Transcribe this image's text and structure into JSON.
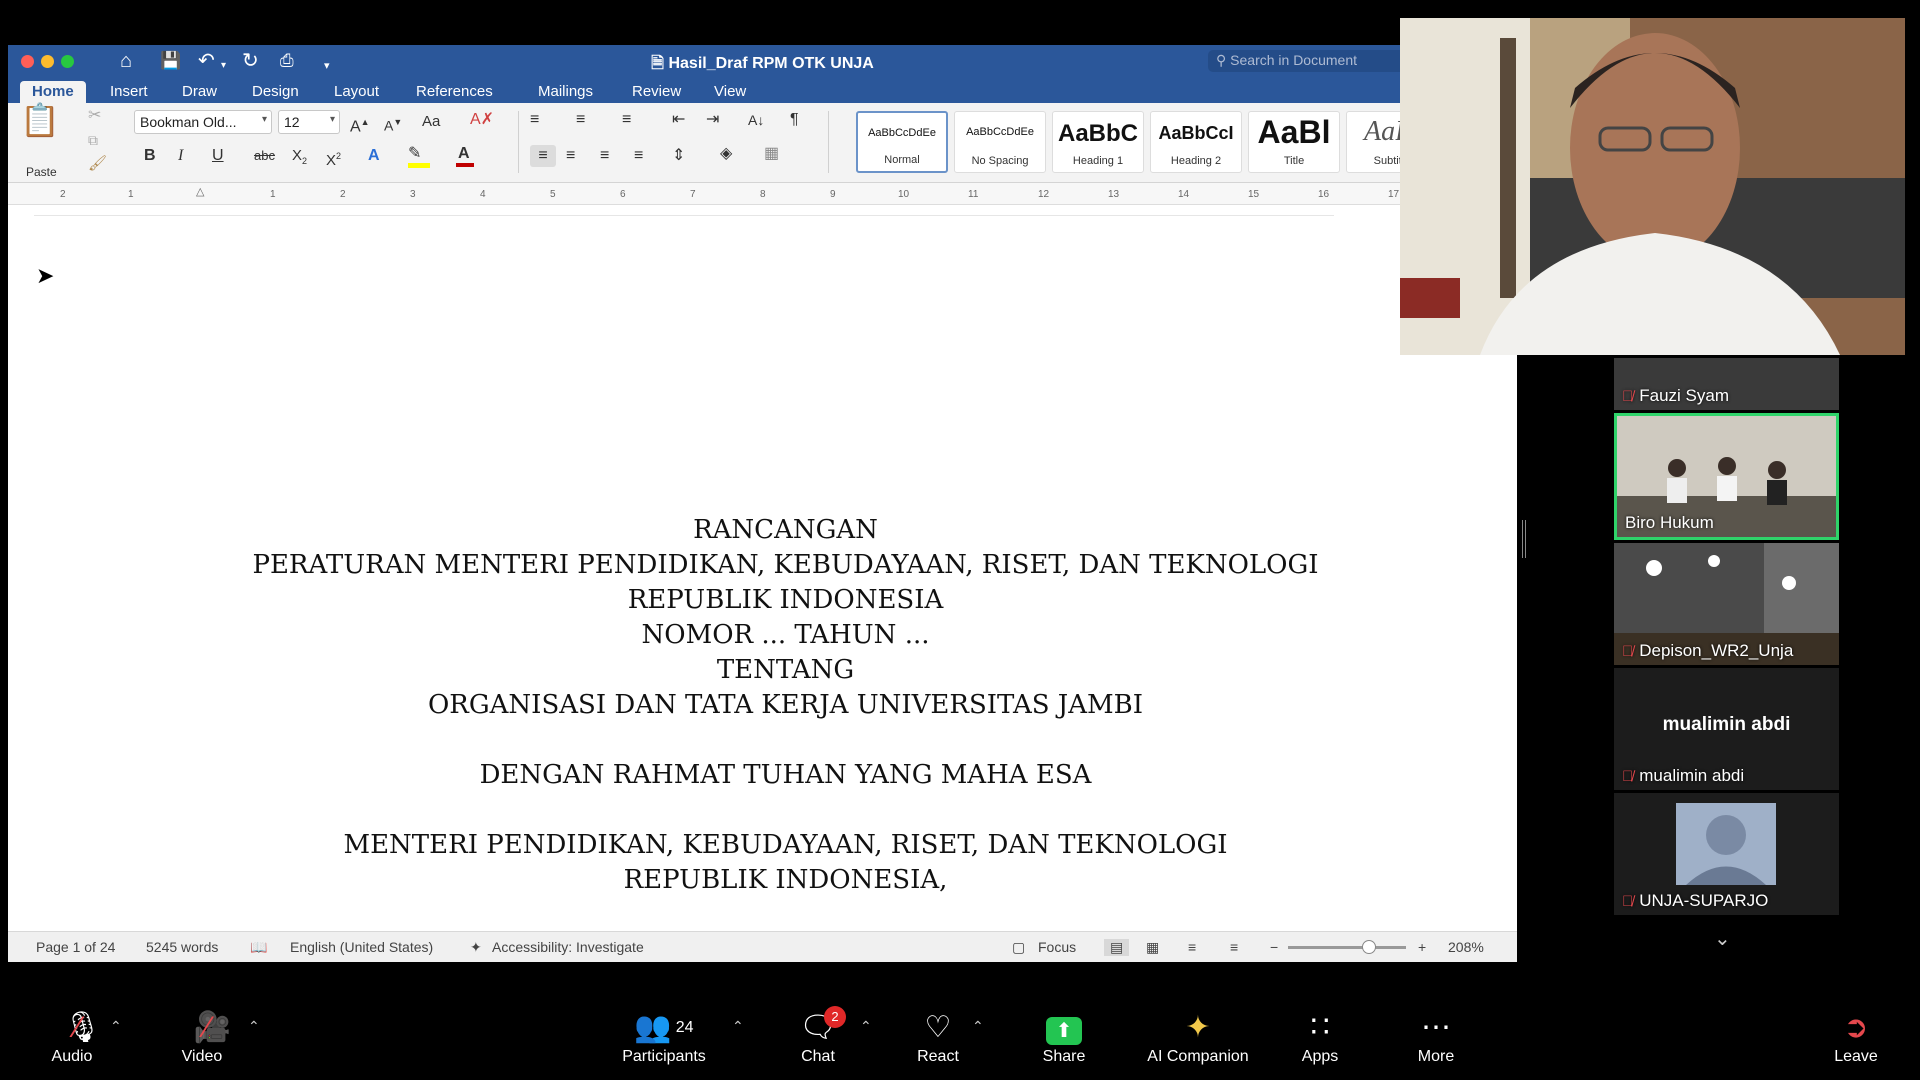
{
  "word": {
    "document_title": "Hasil_Draf RPM OTK UNJA",
    "search_placeholder": "Search in Document",
    "tabs": [
      "Home",
      "Insert",
      "Draw",
      "Design",
      "Layout",
      "References",
      "Mailings",
      "Review",
      "View"
    ],
    "active_tab": "Home",
    "ribbon": {
      "paste_label": "Paste",
      "font_name": "Bookman Old...",
      "font_size": "12",
      "styles": [
        {
          "preview": "AaBbCcDdEe",
          "name": "Normal"
        },
        {
          "preview": "AaBbCcDdEe",
          "name": "No Spacing"
        },
        {
          "preview": "AaBbC",
          "name": "Heading 1"
        },
        {
          "preview": "AaBbCcI",
          "name": "Heading 2"
        },
        {
          "preview": "AaBl",
          "name": "Title"
        },
        {
          "preview": "AaBl",
          "name": "Subtitle"
        }
      ],
      "font_color": "#c00000",
      "highlight_color": "#ffff00"
    },
    "ruler_ticks": [
      "2",
      "1",
      "1",
      "2",
      "3",
      "4",
      "5",
      "6",
      "7",
      "8",
      "9",
      "10",
      "11",
      "12",
      "13",
      "14",
      "15",
      "16",
      "17"
    ],
    "document_lines": [
      "RANCANGAN",
      "PERATURAN MENTERI PENDIDIKAN, KEBUDAYAAN, RISET, DAN TEKNOLOGI",
      "REPUBLIK INDONESIA",
      "NOMOR ... TAHUN ...",
      "TENTANG",
      "ORGANISASI DAN TATA KERJA UNIVERSITAS JAMBI",
      "DENGAN RAHMAT TUHAN YANG MAHA ESA",
      "MENTERI PENDIDIKAN, KEBUDAYAAN, RISET, DAN TEKNOLOGI",
      "REPUBLIK INDONESIA,"
    ],
    "status": {
      "page": "Page 1 of 24",
      "words": "5245 words",
      "language": "English (United States)",
      "accessibility": "Accessibility: Investigate",
      "focus": "Focus",
      "zoom": "208%"
    }
  },
  "participants": [
    {
      "name": "Fauzi Syam",
      "muted": true
    },
    {
      "name": "Biro Hukum",
      "muted": false,
      "active_speaker": true
    },
    {
      "name": "Depison_WR2_Unja",
      "muted": true
    },
    {
      "name": "mualimin abdi",
      "display_name": "mualimin abdi",
      "muted": true
    },
    {
      "name": "UNJA-SUPARJO",
      "muted": true
    }
  ],
  "toolbar": {
    "audio": "Audio",
    "video": "Video",
    "participants": "Participants",
    "participants_count": "24",
    "chat": "Chat",
    "chat_badge": "2",
    "react": "React",
    "share": "Share",
    "ai_companion": "AI Companion",
    "apps": "Apps",
    "more": "More",
    "leave": "Leave"
  },
  "colors": {
    "word_blue": "#2b579a",
    "share_green": "#23c552",
    "active_speaker_border": "#2fd36a",
    "muted_red": "#e5484d",
    "chat_badge": "#e02828"
  }
}
